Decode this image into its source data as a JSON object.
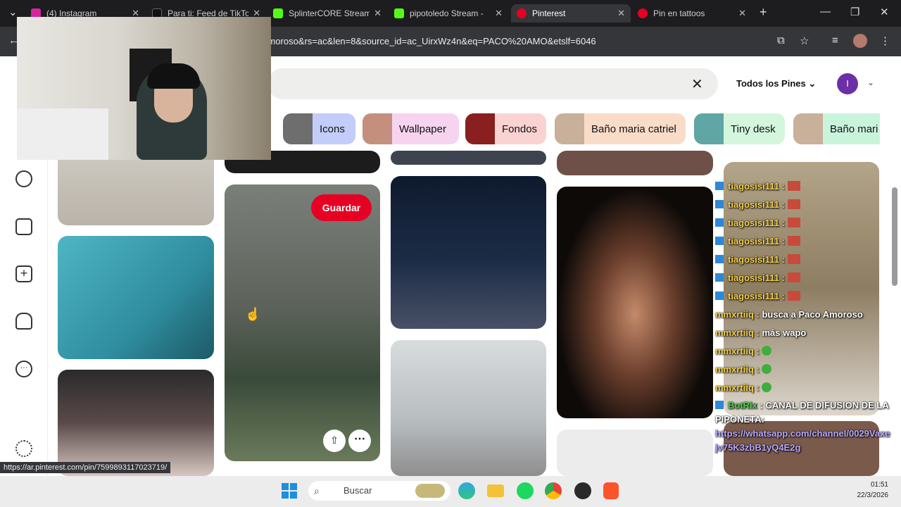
{
  "browser": {
    "tabs": [
      {
        "label": "(4) Instagram",
        "color": "#d6249f"
      },
      {
        "label": "Para ti: Feed de TikTok",
        "color": "#111111"
      },
      {
        "label": "SplinterCORE Stream",
        "color": "#53fc18"
      },
      {
        "label": "pipotoledo Stream - ",
        "color": "#53fc18"
      },
      {
        "label": "Pinterest",
        "color": "#e60023"
      },
      {
        "label": "Pin en tattoos",
        "color": "#e60023"
      }
    ],
    "url": "0amoroso&rs=ac&len=8&source_id=ac_UirxWz4n&eq=PACO%20AMO&etslf=6046",
    "status_url": "https://ar.pinterest.com/pin/7599893117023719/"
  },
  "pinterest": {
    "filter_label": "Todos los Pines",
    "avatar_letter": "I",
    "chips": [
      "Icons",
      "Wallpaper",
      "Fondos",
      "Baño maria catriel",
      "Tiny desk",
      "Baño mari"
    ],
    "save_label": "Guardar"
  },
  "chat": [
    {
      "user": "tiagosisi111 :",
      "msg": ""
    },
    {
      "user": "tiagosisi111 :",
      "msg": ""
    },
    {
      "user": "tiagosisi111 :",
      "msg": ""
    },
    {
      "user": "tiagosisi111 :",
      "msg": ""
    },
    {
      "user": "tiagosisi111 :",
      "msg": ""
    },
    {
      "user": "tiagosisi111 :",
      "msg": ""
    },
    {
      "user": "tiagosisi111 :",
      "msg": ""
    },
    {
      "user": "mmxrtiiq :",
      "msg": "busca a Paco Amoroso"
    },
    {
      "user": "mmxrtiiq :",
      "msg": "más wapo"
    },
    {
      "user": "mmxrtiiq :",
      "msg": ""
    },
    {
      "user": "mmxrtiiq :",
      "msg": ""
    },
    {
      "user": "mmxrtiiq :",
      "msg": ""
    },
    {
      "user": "BotRix",
      "msg": ": CANAL DE DIFUSION DE LA PIPONETA:"
    },
    {
      "user": "",
      "msg": "https://whatsapp.com/channel/0029Vaxe"
    },
    {
      "user": "",
      "msg": "jv75K3zbB1yQ4E2g"
    }
  ],
  "taskbar": {
    "search_placeholder": "Buscar",
    "time": "01:51",
    "date": "22/3/2026"
  },
  "icons": [
    "instagram-icon",
    "tiktok-icon",
    "kick-icon",
    "pinterest-icon",
    "close-icon",
    "plus-icon",
    "minimize-icon",
    "maximize-icon",
    "back-icon",
    "install-icon",
    "star-icon",
    "playlist-icon",
    "profile-icon",
    "menu-icon",
    "compass-icon",
    "board-icon",
    "create-icon",
    "bell-icon",
    "messages-icon",
    "settings-icon",
    "share-icon",
    "more-icon",
    "windows-icon",
    "search-icon",
    "edge-icon",
    "folder-icon",
    "spotify-icon",
    "chrome-icon",
    "obs-icon",
    "brave-icon"
  ]
}
